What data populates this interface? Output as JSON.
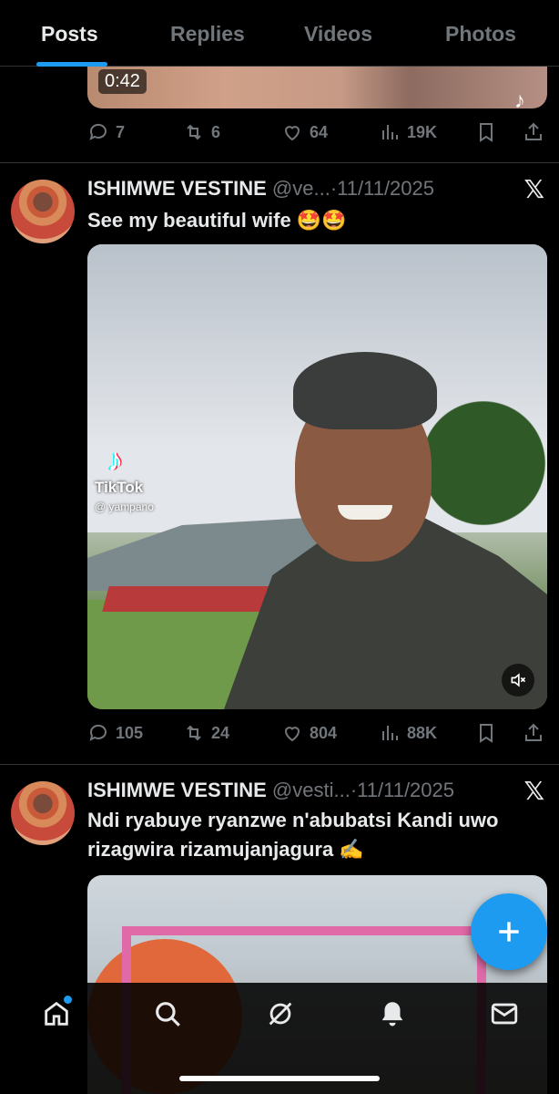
{
  "tabs": [
    {
      "label": "Posts"
    },
    {
      "label": "Replies"
    },
    {
      "label": "Videos"
    },
    {
      "label": "Photos"
    }
  ],
  "post1": {
    "media_duration": "0:42",
    "actions": {
      "replies": "7",
      "reposts": "6",
      "likes": "64",
      "views": "19K"
    }
  },
  "post2": {
    "name": "ISHIMWE VESTINE",
    "handle_date": "@ve...·11/11/2025",
    "text": "See my beautiful wife 🤩🤩",
    "watermark": "TikTok",
    "watermark_handle": "@ yampano",
    "actions": {
      "replies": "105",
      "reposts": "24",
      "likes": "804",
      "views": "88K"
    }
  },
  "post3": {
    "name": "ISHIMWE VESTINE",
    "handle_date": "@vesti...·11/11/2025",
    "text": "Ndi ryabuye ryanzwe n'abubatsi Kandi uwo rizagwira rizamujanjagura ✍️"
  },
  "icons": {
    "x_logo": "𝕏",
    "tiktok_note": "♪"
  },
  "colors": {
    "accent": "#1d9bf0",
    "muted": "#71767b",
    "text": "#e7e9ea"
  }
}
